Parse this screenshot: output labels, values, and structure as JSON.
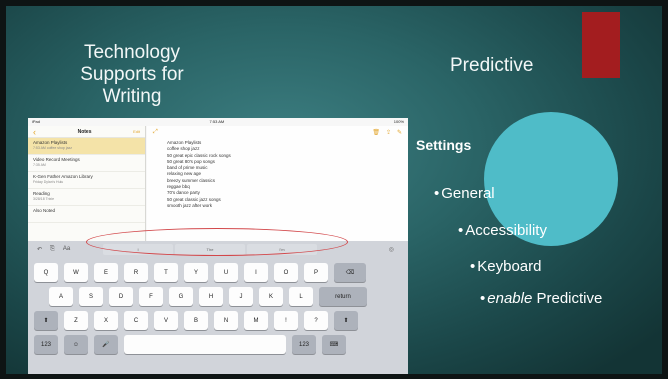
{
  "slide": {
    "left_title_lines": [
      "Technology",
      "Supports for",
      "Writing"
    ],
    "right_title": "Predictive",
    "settings_heading": "Settings",
    "steps": [
      {
        "bullet": "•",
        "text": "General"
      },
      {
        "bullet": "•",
        "text": "Accessibility"
      },
      {
        "bullet": "•",
        "text": "Keyboard"
      },
      {
        "bullet": "•",
        "emphasis": "enable",
        "text": " Predictive"
      }
    ],
    "colors": {
      "accent_red": "#a31d1f",
      "circle": "#4fbcc8",
      "background": "#2a6466",
      "highlight_oval": "#d2474a"
    }
  },
  "ipad": {
    "status": {
      "left": "iPad",
      "center": "7:53 AM",
      "right": "100%"
    },
    "notes": {
      "back_icon": "chevron-left-icon",
      "title": "Notes",
      "edit": "Edit",
      "items": [
        {
          "title": "Amazon Playlists",
          "subtitle": "7:53 AM  coffee shop jazz",
          "active": true
        },
        {
          "title": "Video Record Meetings",
          "subtitle": "7:35 AM",
          "active": false
        },
        {
          "title": "K-Gen Father Amazon Library",
          "subtitle": "Friday  Dylan's Hulu",
          "active": false
        },
        {
          "title": "Reading",
          "subtitle": "3/28/18  Trixie",
          "active": false
        },
        {
          "title": "Also Noted",
          "subtitle": "",
          "active": false
        }
      ]
    },
    "note_lines": [
      "Amazon Playlists",
      "",
      "coffee shop jazz",
      "50 great epic classic rock songs",
      "50 great 80's pop songs",
      "band of prime music",
      "relaxing new age",
      "breezy summer classics",
      "reggae bbq",
      "70's dance party",
      "50 great classic jazz songs",
      "smooth jazz after work"
    ],
    "keyboard": {
      "suggestions": [
        "I",
        "The",
        "I'm"
      ],
      "row1": [
        "Q",
        "W",
        "E",
        "R",
        "T",
        "Y",
        "U",
        "I",
        "O",
        "P",
        "⌫"
      ],
      "row2": [
        "A",
        "S",
        "D",
        "F",
        "G",
        "H",
        "J",
        "K",
        "L",
        "return"
      ],
      "row3": [
        "⬆",
        "Z",
        "X",
        "C",
        "V",
        "B",
        "N",
        "M",
        "!",
        "?",
        "⬆"
      ],
      "row4": [
        "123",
        "☺",
        "🎤",
        "",
        "123",
        "⌨"
      ]
    }
  }
}
